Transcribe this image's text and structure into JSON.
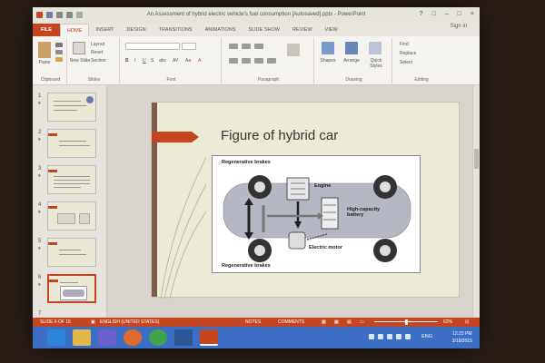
{
  "window": {
    "title": "An Assessment of hybrid electric vehicle's fuel consumption [Autosaved].pptx - PowerPoint",
    "controls": [
      "?",
      "□",
      "–",
      "□",
      "×"
    ],
    "sign_in": "Sign in"
  },
  "tabs": [
    "FILE",
    "HOME",
    "INSERT",
    "DESIGN",
    "TRANSITIONS",
    "ANIMATIONS",
    "SLIDE SHOW",
    "REVIEW",
    "VIEW"
  ],
  "ribbon": {
    "clipboard": {
      "label": "Clipboard",
      "paste": "Paste"
    },
    "slides": {
      "label": "Slides",
      "new_slide": "New Slide",
      "layout": "Layout",
      "reset": "Reset",
      "section": "Section"
    },
    "font": {
      "label": "Font",
      "bold": "B",
      "italic": "I",
      "underline": "U",
      "strike": "S",
      "shadow": "abc",
      "spacing": "AV",
      "case": "Aa",
      "color": "A"
    },
    "paragraph": {
      "label": "Paragraph"
    },
    "drawing": {
      "label": "Drawing",
      "shapes": "Shapes",
      "arrange": "Arrange",
      "quick_styles": "Quick Styles"
    },
    "editing": {
      "label": "Editing",
      "find": "Find",
      "replace": "Replace",
      "select": "Select"
    }
  },
  "thumbnails": [
    "1",
    "2",
    "3",
    "4",
    "5",
    "6",
    "7"
  ],
  "slide": {
    "title": "Figure of hybrid car",
    "labels": {
      "regen_top": "Regenerative brakes",
      "engine": "Engine",
      "battery": "High-capacity battery",
      "motor": "Electric motor",
      "regen_bottom": "Regenerative brakes"
    }
  },
  "statusbar": {
    "slide_info": "SLIDE 6 OF 15",
    "language": "ENGLISH (UNITED STATES)",
    "notes": "NOTES",
    "comments": "COMMENTS",
    "zoom": "62%"
  },
  "taskbar": {
    "lang": "ENG",
    "time": "12:23 PM",
    "date": "3/18/2015"
  },
  "colors": {
    "accent": "#c4451f",
    "taskbar": "#3c6fc4"
  }
}
